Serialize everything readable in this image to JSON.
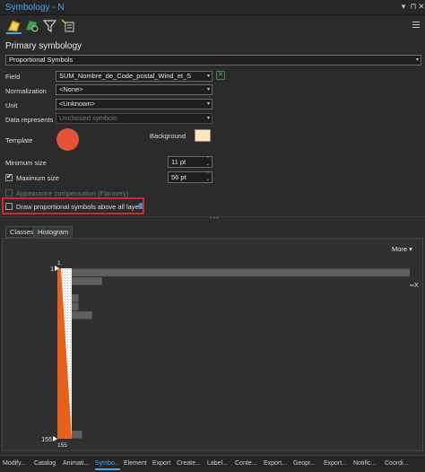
{
  "title": "Symbology - N",
  "tools": [
    "primary-symbology-icon",
    "vary-symbology-icon",
    "filter-icon",
    "label-classes-icon"
  ],
  "section_title": "Primary symbology",
  "renderer": "Proportional Symbols",
  "field": {
    "label": "Field",
    "value": "SUM_Nombre_de_Code_postal_Wind_et_S"
  },
  "normalization": {
    "label": "Normalization",
    "value": "<None>"
  },
  "unit": {
    "label": "Unit",
    "value": "<Unknown>"
  },
  "data_represents": {
    "label": "Data represents",
    "value": "Unclassed symbols"
  },
  "template_label": "Template",
  "background_label": "Background",
  "template_color": "#e55237",
  "background_color": "#fbe6bd",
  "min_size": {
    "label": "Minimum size",
    "value": "11 pt"
  },
  "max_size": {
    "label": "Maximum size",
    "value": "56 pt",
    "checked": true
  },
  "appearance_comp": {
    "label": "Appearance compensation (Flannery)",
    "checked": false,
    "enabled": false
  },
  "draw_above": {
    "label": "Draw proportional symbols above all layers",
    "checked": false
  },
  "tabs": [
    "Classes",
    "Histogram"
  ],
  "active_tab": "Histogram",
  "more_label": "More",
  "chart_data": {
    "type": "bar",
    "tick_top": "1",
    "tick_bottom": "155",
    "min_label": "1",
    "max_label": "155",
    "hist_values": [
      100,
      9,
      0,
      2,
      2,
      6,
      0,
      0,
      0,
      0,
      0,
      0,
      0,
      0,
      0,
      0,
      0,
      0,
      0,
      3
    ],
    "hist_max": 100,
    "exclude_label": "X"
  },
  "bottom_tabs": [
    "Modify...",
    "Catalog",
    "Animati...",
    "Symbo...",
    "Element",
    "Export",
    "Create...",
    "Label...",
    "Conte...",
    "Export...",
    "Geopr...",
    "Export...",
    "Notific...",
    "Coordi..."
  ],
  "active_bottom_tab": "Symbo..."
}
